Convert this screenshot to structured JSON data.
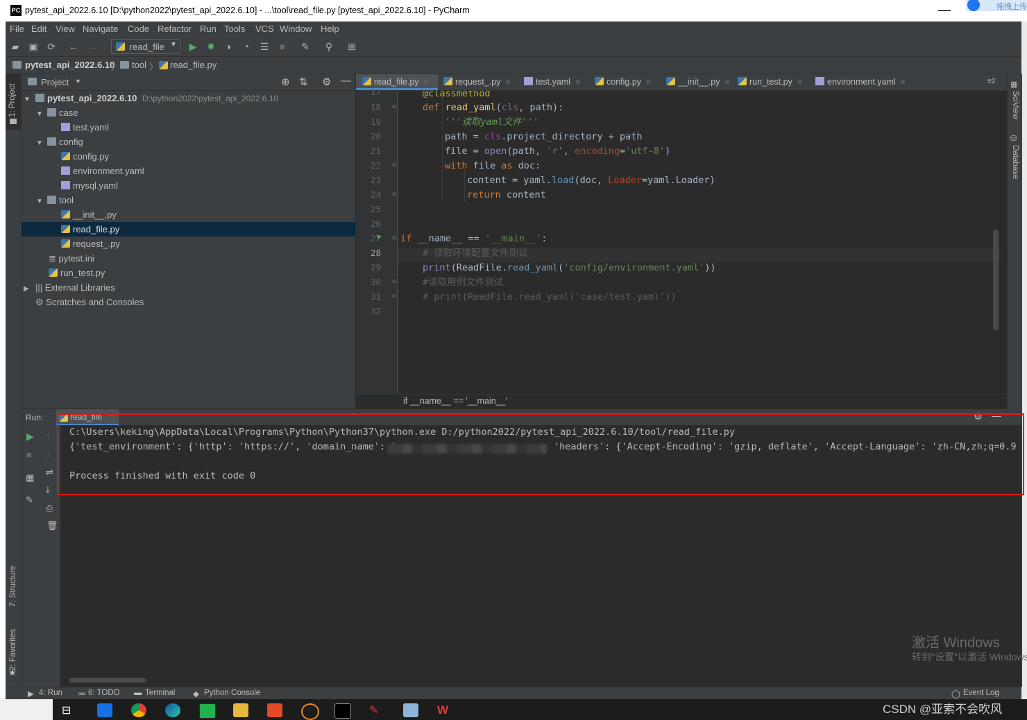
{
  "window": {
    "title": "pytest_api_2022.6.10 [D:\\python2022\\pytest_api_2022.6.10] - ...\\tool\\read_file.py [pytest_api_2022.6.10] - PyCharm",
    "app_icon": "PC",
    "minimize": "—",
    "corner_badge": "拖拽上传"
  },
  "menu": [
    "File",
    "Edit",
    "View",
    "Navigate",
    "Code",
    "Refactor",
    "Run",
    "Tools",
    "VCS",
    "Window",
    "Help"
  ],
  "toolbar": {
    "run_config": "read_file"
  },
  "navbar": {
    "project": "pytest_api_2022.6.10",
    "folder": "tool",
    "file": "read_file.py"
  },
  "left_strip": {
    "project": "1: Project",
    "structure": "7: Structure",
    "favorites": "2: Favorites"
  },
  "right_strip": {
    "sciview": "SciView",
    "database": "Database"
  },
  "project_panel": {
    "header": "Project",
    "tree": [
      {
        "label": "pytest_api_2022.6.10",
        "path": "D:\\python2022\\pytest_api_2022.6.10"
      },
      {
        "label": "case"
      },
      {
        "label": "test.yaml"
      },
      {
        "label": "config"
      },
      {
        "label": "config.py"
      },
      {
        "label": "environment.yaml"
      },
      {
        "label": "mysql.yaml"
      },
      {
        "label": "tool"
      },
      {
        "label": "__init__.py"
      },
      {
        "label": "read_file.py"
      },
      {
        "label": "request_.py"
      },
      {
        "label": "pytest.ini"
      },
      {
        "label": "run_test.py"
      },
      {
        "label": "External Libraries"
      },
      {
        "label": "Scratches and Consoles"
      }
    ]
  },
  "editor": {
    "tabs": [
      "read_file.py",
      "request_.py",
      "test.yaml",
      "config.py",
      "__init__.py",
      "run_test.py",
      "environment.yaml"
    ],
    "tab_count": "≡2",
    "line_numbers": [
      "17",
      "18",
      "19",
      "20",
      "21",
      "22",
      "23",
      "24",
      "25",
      "26",
      "27",
      "28",
      "29",
      "30",
      "31",
      "32"
    ],
    "code": {
      "l17": "@classmethod",
      "l18_kw": "def ",
      "l18_fn": "read_yaml",
      "l18_a": "(",
      "l18_self": "cls",
      "l18_b": ", path):",
      "l19": "'''读取yaml文件'''",
      "l20_a": "path = ",
      "l20_self": "cls",
      "l20_b": ".project_directory + path",
      "l21_a": "file = ",
      "l21_bi": "open",
      "l21_b": "(path, ",
      "l21_s1": "'r'",
      "l21_c": ", ",
      "l21_par": "encoding",
      "l21_d": "=",
      "l21_s2": "'utf-8'",
      "l21_e": ")",
      "l22_kw": "with ",
      "l22_a": "file ",
      "l22_kw2": "as ",
      "l22_b": "doc:",
      "l23_a": "content = yaml.",
      "l23_fn": "load",
      "l23_b": "(doc, ",
      "l23_par": "Loader",
      "l23_c": "=yaml.Loader)",
      "l24_kw": "return ",
      "l24_a": "content",
      "l27_kw": "if ",
      "l27_a": "__name__ == ",
      "l27_s": "'__main__'",
      "l27_b": ":",
      "l28": "# 读取环境配置文件测试",
      "l29_bi": "print",
      "l29_a": "(ReadFile.",
      "l29_fn": "read_yaml",
      "l29_b": "(",
      "l29_s": "'config/environment.yaml'",
      "l29_c": "))",
      "l30": "#读取用例文件测试",
      "l31": "# print(ReadFile.read_yaml('case/test.yaml'))"
    },
    "breadcrumb": "if __name__ == '__main__'"
  },
  "run_panel": {
    "label": "Run:",
    "tab": "read_file",
    "output": [
      "C:\\Users\\keking\\AppData\\Local\\Programs\\Python\\Python37\\python.exe D:/python2022/pytest_api_2022.6.10/tool/read_file.py",
      "{'test_environment': {'http': 'https://', 'domain_name': '",
      "'headers': {'Accept-Encoding': 'gzip, deflate', 'Accept-Language': 'zh-CN,zh;q=0.9",
      "Process finished with exit code 0"
    ]
  },
  "bottom_bar": {
    "run": "4: Run",
    "todo": "6: TODO",
    "terminal": "Terminal",
    "python_console": "Python Console",
    "event_log": "Event Log"
  },
  "overlay": {
    "activate_title": "激活 Windows",
    "activate_sub": "转到\"设置\"以激活 Windows。",
    "csdn": "CSDN @亚索不会吹风"
  },
  "colors": {
    "highlight_box": "#e0191b",
    "selection": "#0d293e",
    "tab_accent": "#4a88c7"
  }
}
